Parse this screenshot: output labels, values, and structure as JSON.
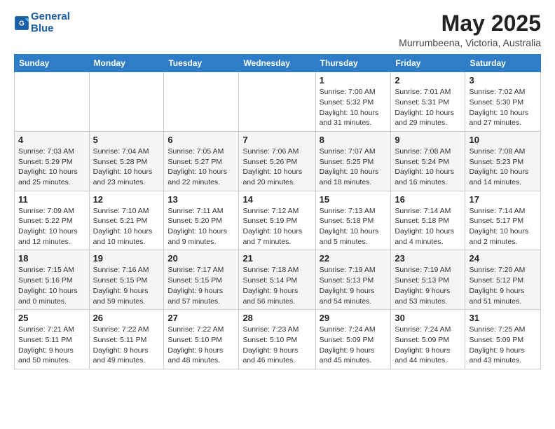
{
  "header": {
    "logo_line1": "General",
    "logo_line2": "Blue",
    "month": "May 2025",
    "location": "Murrumbeena, Victoria, Australia"
  },
  "days_of_week": [
    "Sunday",
    "Monday",
    "Tuesday",
    "Wednesday",
    "Thursday",
    "Friday",
    "Saturday"
  ],
  "weeks": [
    [
      {
        "day": "",
        "info": ""
      },
      {
        "day": "",
        "info": ""
      },
      {
        "day": "",
        "info": ""
      },
      {
        "day": "",
        "info": ""
      },
      {
        "day": "1",
        "info": "Sunrise: 7:00 AM\nSunset: 5:32 PM\nDaylight: 10 hours\nand 31 minutes."
      },
      {
        "day": "2",
        "info": "Sunrise: 7:01 AM\nSunset: 5:31 PM\nDaylight: 10 hours\nand 29 minutes."
      },
      {
        "day": "3",
        "info": "Sunrise: 7:02 AM\nSunset: 5:30 PM\nDaylight: 10 hours\nand 27 minutes."
      }
    ],
    [
      {
        "day": "4",
        "info": "Sunrise: 7:03 AM\nSunset: 5:29 PM\nDaylight: 10 hours\nand 25 minutes."
      },
      {
        "day": "5",
        "info": "Sunrise: 7:04 AM\nSunset: 5:28 PM\nDaylight: 10 hours\nand 23 minutes."
      },
      {
        "day": "6",
        "info": "Sunrise: 7:05 AM\nSunset: 5:27 PM\nDaylight: 10 hours\nand 22 minutes."
      },
      {
        "day": "7",
        "info": "Sunrise: 7:06 AM\nSunset: 5:26 PM\nDaylight: 10 hours\nand 20 minutes."
      },
      {
        "day": "8",
        "info": "Sunrise: 7:07 AM\nSunset: 5:25 PM\nDaylight: 10 hours\nand 18 minutes."
      },
      {
        "day": "9",
        "info": "Sunrise: 7:08 AM\nSunset: 5:24 PM\nDaylight: 10 hours\nand 16 minutes."
      },
      {
        "day": "10",
        "info": "Sunrise: 7:08 AM\nSunset: 5:23 PM\nDaylight: 10 hours\nand 14 minutes."
      }
    ],
    [
      {
        "day": "11",
        "info": "Sunrise: 7:09 AM\nSunset: 5:22 PM\nDaylight: 10 hours\nand 12 minutes."
      },
      {
        "day": "12",
        "info": "Sunrise: 7:10 AM\nSunset: 5:21 PM\nDaylight: 10 hours\nand 10 minutes."
      },
      {
        "day": "13",
        "info": "Sunrise: 7:11 AM\nSunset: 5:20 PM\nDaylight: 10 hours\nand 9 minutes."
      },
      {
        "day": "14",
        "info": "Sunrise: 7:12 AM\nSunset: 5:19 PM\nDaylight: 10 hours\nand 7 minutes."
      },
      {
        "day": "15",
        "info": "Sunrise: 7:13 AM\nSunset: 5:18 PM\nDaylight: 10 hours\nand 5 minutes."
      },
      {
        "day": "16",
        "info": "Sunrise: 7:14 AM\nSunset: 5:18 PM\nDaylight: 10 hours\nand 4 minutes."
      },
      {
        "day": "17",
        "info": "Sunrise: 7:14 AM\nSunset: 5:17 PM\nDaylight: 10 hours\nand 2 minutes."
      }
    ],
    [
      {
        "day": "18",
        "info": "Sunrise: 7:15 AM\nSunset: 5:16 PM\nDaylight: 10 hours\nand 0 minutes."
      },
      {
        "day": "19",
        "info": "Sunrise: 7:16 AM\nSunset: 5:15 PM\nDaylight: 9 hours\nand 59 minutes."
      },
      {
        "day": "20",
        "info": "Sunrise: 7:17 AM\nSunset: 5:15 PM\nDaylight: 9 hours\nand 57 minutes."
      },
      {
        "day": "21",
        "info": "Sunrise: 7:18 AM\nSunset: 5:14 PM\nDaylight: 9 hours\nand 56 minutes."
      },
      {
        "day": "22",
        "info": "Sunrise: 7:19 AM\nSunset: 5:13 PM\nDaylight: 9 hours\nand 54 minutes."
      },
      {
        "day": "23",
        "info": "Sunrise: 7:19 AM\nSunset: 5:13 PM\nDaylight: 9 hours\nand 53 minutes."
      },
      {
        "day": "24",
        "info": "Sunrise: 7:20 AM\nSunset: 5:12 PM\nDaylight: 9 hours\nand 51 minutes."
      }
    ],
    [
      {
        "day": "25",
        "info": "Sunrise: 7:21 AM\nSunset: 5:11 PM\nDaylight: 9 hours\nand 50 minutes."
      },
      {
        "day": "26",
        "info": "Sunrise: 7:22 AM\nSunset: 5:11 PM\nDaylight: 9 hours\nand 49 minutes."
      },
      {
        "day": "27",
        "info": "Sunrise: 7:22 AM\nSunset: 5:10 PM\nDaylight: 9 hours\nand 48 minutes."
      },
      {
        "day": "28",
        "info": "Sunrise: 7:23 AM\nSunset: 5:10 PM\nDaylight: 9 hours\nand 46 minutes."
      },
      {
        "day": "29",
        "info": "Sunrise: 7:24 AM\nSunset: 5:09 PM\nDaylight: 9 hours\nand 45 minutes."
      },
      {
        "day": "30",
        "info": "Sunrise: 7:24 AM\nSunset: 5:09 PM\nDaylight: 9 hours\nand 44 minutes."
      },
      {
        "day": "31",
        "info": "Sunrise: 7:25 AM\nSunset: 5:09 PM\nDaylight: 9 hours\nand 43 minutes."
      }
    ]
  ]
}
